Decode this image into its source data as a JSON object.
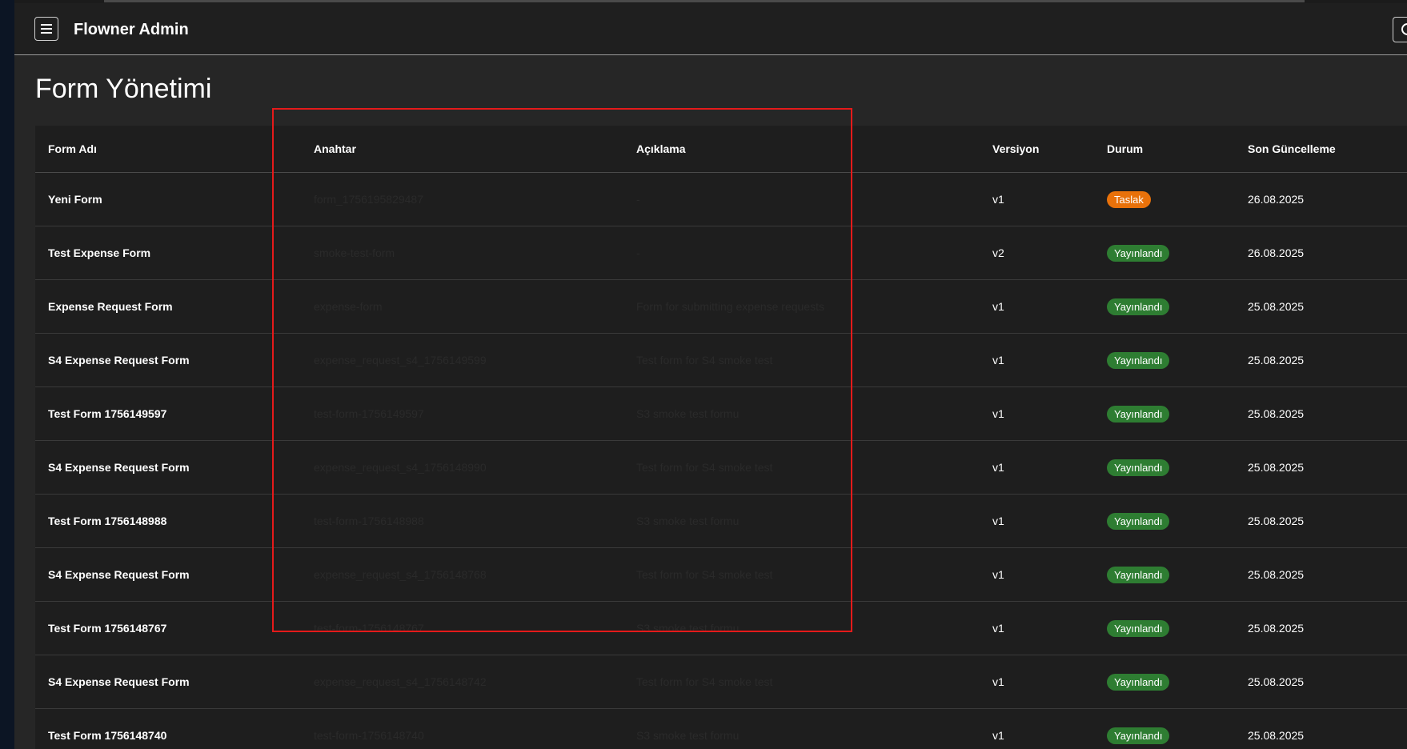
{
  "app": {
    "title": "Flowner Admin"
  },
  "page": {
    "title": "Form Yönetimi"
  },
  "table": {
    "headers": {
      "name": "Form Adı",
      "key": "Anahtar",
      "description": "Açıklama",
      "version": "Versiyon",
      "status": "Durum",
      "updated": "Son Güncelleme"
    },
    "rows": [
      {
        "name": "Yeni Form",
        "key": "form_1756195829487",
        "description": "-",
        "version": "v1",
        "status": "Taslak",
        "status_type": "draft",
        "updated": "26.08.2025"
      },
      {
        "name": "Test Expense Form",
        "key": "smoke-test-form",
        "description": "-",
        "version": "v2",
        "status": "Yayınlandı",
        "status_type": "published",
        "updated": "26.08.2025"
      },
      {
        "name": "Expense Request Form",
        "key": "expense-form",
        "description": "Form for submitting expense requests",
        "version": "v1",
        "status": "Yayınlandı",
        "status_type": "published",
        "updated": "25.08.2025"
      },
      {
        "name": "S4 Expense Request Form",
        "key": "expense_request_s4_1756149599",
        "description": "Test form for S4 smoke test",
        "version": "v1",
        "status": "Yayınlandı",
        "status_type": "published",
        "updated": "25.08.2025"
      },
      {
        "name": "Test Form 1756149597",
        "key": "test-form-1756149597",
        "description": "S3 smoke test formu",
        "version": "v1",
        "status": "Yayınlandı",
        "status_type": "published",
        "updated": "25.08.2025"
      },
      {
        "name": "S4 Expense Request Form",
        "key": "expense_request_s4_1756148990",
        "description": "Test form for S4 smoke test",
        "version": "v1",
        "status": "Yayınlandı",
        "status_type": "published",
        "updated": "25.08.2025"
      },
      {
        "name": "Test Form 1756148988",
        "key": "test-form-1756148988",
        "description": "S3 smoke test formu",
        "version": "v1",
        "status": "Yayınlandı",
        "status_type": "published",
        "updated": "25.08.2025"
      },
      {
        "name": "S4 Expense Request Form",
        "key": "expense_request_s4_1756148768",
        "description": "Test form for S4 smoke test",
        "version": "v1",
        "status": "Yayınlandı",
        "status_type": "published",
        "updated": "25.08.2025"
      },
      {
        "name": "Test Form 1756148767",
        "key": "test-form-1756148767",
        "description": "S3 smoke test formu",
        "version": "v1",
        "status": "Yayınlandı",
        "status_type": "published",
        "updated": "25.08.2025"
      },
      {
        "name": "S4 Expense Request Form",
        "key": "expense_request_s4_1756148742",
        "description": "Test form for S4 smoke test",
        "version": "v1",
        "status": "Yayınlandı",
        "status_type": "published",
        "updated": "25.08.2025"
      },
      {
        "name": "Test Form 1756148740",
        "key": "test-form-1756148740",
        "description": "S3 smoke test formu",
        "version": "v1",
        "status": "Yayınlandı",
        "status_type": "published",
        "updated": "25.08.2025"
      }
    ]
  },
  "colors": {
    "draft": "#e8710a",
    "published": "#2e7d32",
    "highlight": "#e51a1a"
  },
  "icons": {
    "menu": "hamburger-menu-icon",
    "search": "search-icon"
  }
}
